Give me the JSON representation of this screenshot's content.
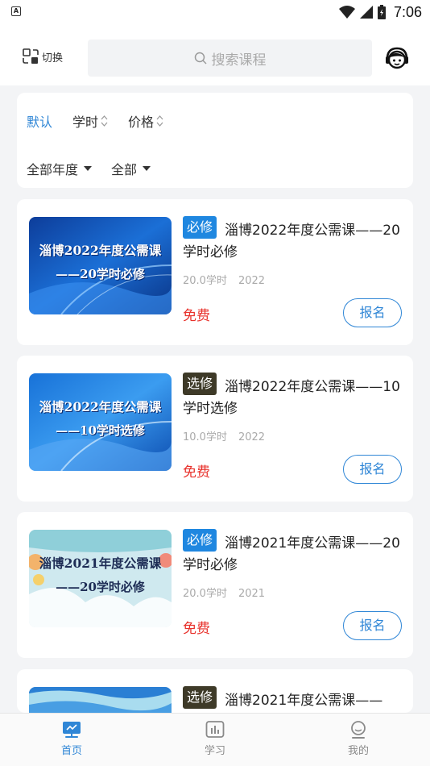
{
  "status_bar": {
    "app_badge": "A",
    "time": "7:06"
  },
  "header": {
    "switch_label": "切换",
    "search_placeholder": "搜索课程"
  },
  "filters": {
    "sort": [
      "默认",
      "学时",
      "价格"
    ],
    "year_dropdown": "全部年度",
    "type_dropdown": "全部"
  },
  "courses": [
    {
      "tag": "必修",
      "tag_type": "required",
      "title": "淄博2022年度公需课——20学时必修",
      "thumb_line1": "淄博2022年度公需课",
      "thumb_line2": "——20学时必修",
      "hours": "20.0学时",
      "year": "2022",
      "price": "免费",
      "action": "报名"
    },
    {
      "tag": "选修",
      "tag_type": "elective",
      "title": "淄博2022年度公需课——10学时选修",
      "thumb_line1": "淄博2022年度公需课",
      "thumb_line2": "——10学时选修",
      "hours": "10.0学时",
      "year": "2022",
      "price": "免费",
      "action": "报名"
    },
    {
      "tag": "必修",
      "tag_type": "required",
      "title": "淄博2021年度公需课——20学时必修",
      "thumb_line1": "淄博2021年度公需课",
      "thumb_line2": "——20学时必修",
      "hours": "20.0学时",
      "year": "2021",
      "price": "免费",
      "action": "报名"
    },
    {
      "tag": "选修",
      "tag_type": "elective",
      "title": "淄博2021年度公需课——"
    }
  ],
  "bottom_nav": [
    {
      "label": "首页",
      "icon": "home-board-icon",
      "active": true
    },
    {
      "label": "学习",
      "icon": "study-chart-icon",
      "active": false
    },
    {
      "label": "我的",
      "icon": "profile-icon",
      "active": false
    }
  ],
  "colors": {
    "accent": "#2f86d6",
    "price": "#e8322c",
    "required_tag": "#1f87e0",
    "elective_tag": "#3e3a28"
  }
}
